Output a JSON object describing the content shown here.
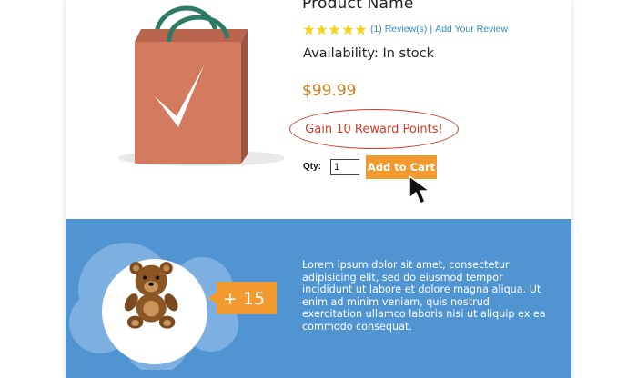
{
  "product": {
    "name": "Product Name",
    "rating": 5,
    "reviews_link": "(1) Review(s)",
    "separator": "|",
    "add_review_link": "Add Your Review",
    "availability": "Availability: In stock",
    "price": "$99.99",
    "reward": "Gain 10 Reward Points!",
    "qty_label": "Qty:",
    "qty_value": "1",
    "add_to_cart": "Add to Cart"
  },
  "promo": {
    "badge": "+ 15",
    "description": "Lorem ipsum dolor sit amet, consectetur adipisicing elit, sed do eiusmod tempor incididunt ut labore et dolore magna aliqua. Ut enim ad minim veniam, quis nostrud exercitation ullamco laboris nisi ut aliquip ex ea commodo consequat."
  },
  "colors": {
    "accent_orange": "#f29a2e",
    "price_orange": "#d07d1f",
    "reward_red": "#d23a2a",
    "link_blue": "#2f8fc4",
    "section_blue": "#5194d2",
    "bag": "#d47a5f",
    "star": "#f5d41f"
  },
  "icons": {
    "product_image": "shopping-bag-icon",
    "stars": "star-icon",
    "cursor": "mouse-pointer-icon",
    "mascot": "teddy-bear-icon"
  }
}
